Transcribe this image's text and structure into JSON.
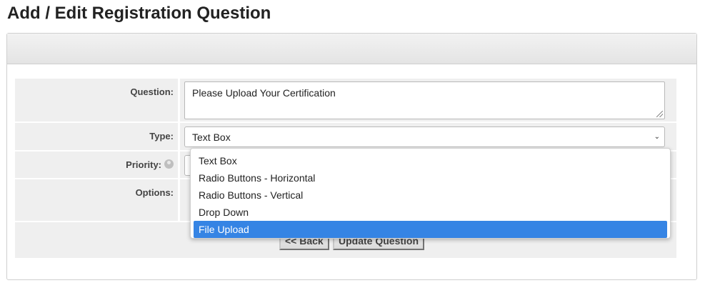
{
  "page": {
    "title": "Add / Edit Registration Question"
  },
  "form": {
    "question": {
      "label": "Question:",
      "value": "Please Upload Your Certification"
    },
    "type": {
      "label": "Type:",
      "selected": "Text Box",
      "options": [
        "Text Box",
        "Radio Buttons - Horizontal",
        "Radio Buttons - Vertical",
        "Drop Down",
        "File Upload"
      ],
      "highlighted": "File Upload"
    },
    "priority": {
      "label": "Priority:",
      "value": ""
    },
    "options": {
      "label": "Options:"
    }
  },
  "buttons": {
    "back": "<< Back",
    "update": "Update Question"
  },
  "colors": {
    "highlight": "#3584e4",
    "row_background": "#efefef"
  }
}
